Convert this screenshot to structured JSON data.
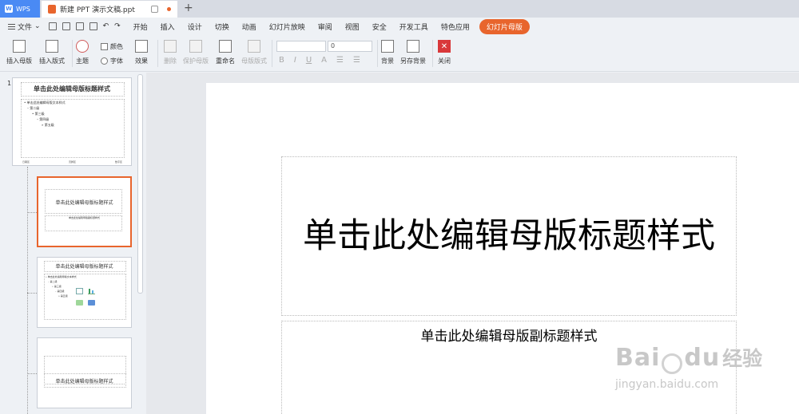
{
  "titlebar": {
    "app_tab": "WPS",
    "doc_tab": "新建 PPT 演示文稿.ppt",
    "new_tab": "+"
  },
  "menubar": {
    "file": "文件",
    "items": [
      "开始",
      "插入",
      "设计",
      "切换",
      "动画",
      "幻灯片放映",
      "审阅",
      "视图",
      "安全",
      "开发工具",
      "特色应用"
    ],
    "active": "幻灯片母版"
  },
  "ribbon": {
    "insert_master": "插入母版",
    "insert_layout": "插入版式",
    "theme": "主题",
    "color": "颜色",
    "font": "字体",
    "effect": "效果",
    "delete": "删除",
    "protect_master": "保护母版",
    "rename": "重命名",
    "master_layout": "母版版式",
    "font_size": "0",
    "background": "背景",
    "save_background": "另存背景",
    "close": "关闭",
    "close_icon": "✕"
  },
  "thumbnails": {
    "slide_number": "1",
    "master": {
      "title": "单击此处编辑母版标题样式",
      "body_lines": [
        "• 单击此处编辑母版文本样式",
        "– 第二级",
        "• 第三级",
        "– 第四级",
        "» 第五级"
      ],
      "footers": [
        "日期区",
        "页脚区",
        "数字区"
      ]
    },
    "layout1": {
      "title": "单击此处编辑母版标题样式",
      "subtitle": "单击此处编辑母版副标题样式"
    },
    "layout2": {
      "title": "单击此处编辑母版标题样式",
      "body_lines": [
        "• 单击此处编辑母版文本样式",
        "– 第二级",
        "• 第三级",
        "– 第四级",
        "» 第五级"
      ]
    },
    "layout3": {
      "title": "单击此处编辑母版标题样式"
    }
  },
  "slide": {
    "title": "单击此处编辑母版标题样式",
    "subtitle": "单击此处编辑母版副标题样式"
  },
  "watermark": {
    "brand": "Bai",
    "brand2": "du",
    "cn": "经验",
    "url": "jingyan.baidu.com"
  },
  "colors": {
    "accent": "#e8652d",
    "wps_blue": "#4a8af4",
    "close_red": "#d9383a"
  }
}
